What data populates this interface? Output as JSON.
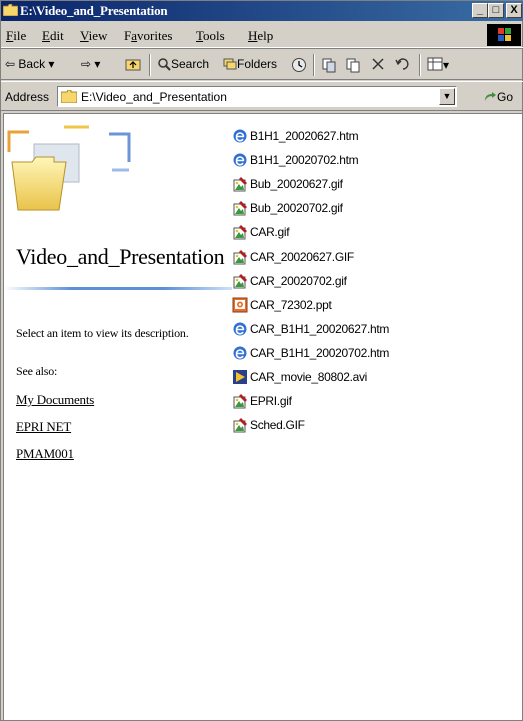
{
  "window": {
    "title": "E:\\Video_and_Presentation"
  },
  "menu": [
    "File",
    "Edit",
    "View",
    "Favorites",
    "Tools",
    "Help"
  ],
  "menu_underline": [
    "F",
    "E",
    "V",
    "a",
    "T",
    "H"
  ],
  "toolbar": {
    "back": "Back",
    "search": "Search",
    "folders": "Folders"
  },
  "address": {
    "label": "Address",
    "value": "E:\\Video_and_Presentation",
    "go": "Go"
  },
  "left_panel": {
    "folder_name": "Video_and_Presentation",
    "description": "Select an item to view its description.",
    "see_also": "See also:",
    "links": [
      "My Documents",
      "EPRI NET",
      "PMAM001"
    ]
  },
  "files": [
    {
      "name": "B1H1_20020627.htm",
      "icon": "ie-htm-icon"
    },
    {
      "name": "B1H1_20020702.htm",
      "icon": "ie-htm-icon"
    },
    {
      "name": "Bub_20020627.gif",
      "icon": "gif-image-icon"
    },
    {
      "name": "Bub_20020702.gif",
      "icon": "gif-image-icon"
    },
    {
      "name": "CAR.gif",
      "icon": "gif-image-icon"
    },
    {
      "name": "CAR_20020627.GIF",
      "icon": "gif-image-icon"
    },
    {
      "name": "CAR_20020702.gif",
      "icon": "gif-image-icon"
    },
    {
      "name": "CAR_72302.ppt",
      "icon": "powerpoint-icon"
    },
    {
      "name": "CAR_B1H1_20020627.htm",
      "icon": "ie-htm-icon"
    },
    {
      "name": "CAR_B1H1_20020702.htm",
      "icon": "ie-htm-icon"
    },
    {
      "name": "CAR_movie_80802.avi",
      "icon": "avi-video-icon"
    },
    {
      "name": "EPRI.gif",
      "icon": "gif-image-icon"
    },
    {
      "name": "Sched.GIF",
      "icon": "gif-image-icon"
    }
  ],
  "colors": {
    "titlebar": "#0a246a",
    "accent_line": "#5b8fd6",
    "chrome": "#d4d0c8"
  }
}
